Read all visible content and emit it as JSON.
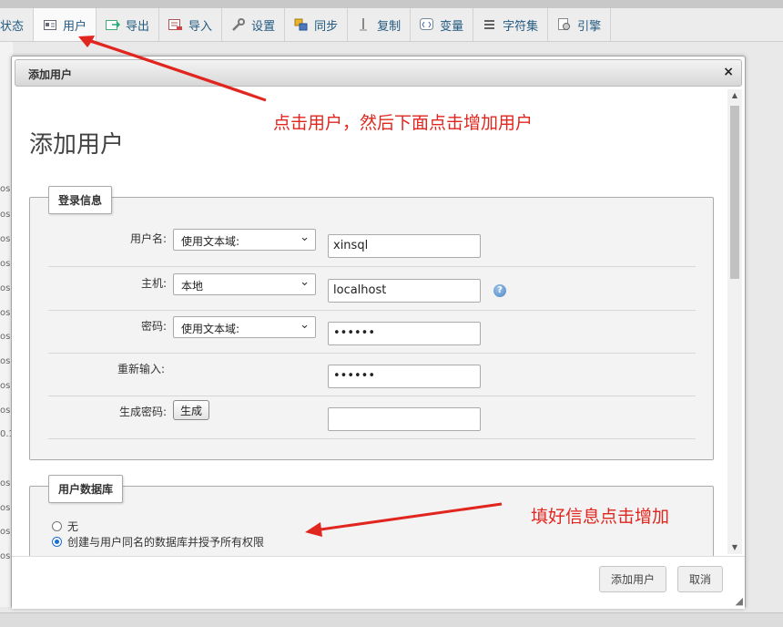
{
  "tabs": [
    {
      "label": "状态",
      "icon": "status-icon"
    },
    {
      "label": "用户",
      "icon": "users-icon"
    },
    {
      "label": "导出",
      "icon": "export-icon"
    },
    {
      "label": "导入",
      "icon": "import-icon"
    },
    {
      "label": "设置",
      "icon": "wrench-icon"
    },
    {
      "label": "同步",
      "icon": "sync-icon"
    },
    {
      "label": "复制",
      "icon": "replication-icon"
    },
    {
      "label": "变量",
      "icon": "variables-icon"
    },
    {
      "label": "字符集",
      "icon": "charset-icon"
    },
    {
      "label": "引擎",
      "icon": "engine-icon"
    }
  ],
  "background": {
    "rows": [
      "os",
      "os",
      "os",
      "os",
      "os",
      "os",
      "os",
      "os",
      "os",
      "os",
      "0.1",
      "os",
      "os",
      "os",
      "os"
    ]
  },
  "dialog": {
    "title": "添加用户",
    "close_glyph": "×",
    "heading": "添加用户",
    "login": {
      "legend": "登录信息",
      "username_label": "用户名:",
      "username_select": "使用文本域:",
      "username_value": "xinsql",
      "host_label": "主机:",
      "host_select": "本地",
      "host_value": "localhost",
      "password_label": "密码:",
      "password_select": "使用文本域:",
      "password_value": "••••••",
      "retype_label": "重新输入:",
      "retype_value": "••••••",
      "generate_label": "生成密码:",
      "generate_button": "生成",
      "generate_value": ""
    },
    "database": {
      "legend": "用户数据库",
      "option_none": "无",
      "option_create": "创建与用户同名的数据库并授予所有权限",
      "selected": "option_create"
    },
    "footer": {
      "add_button": "添加用户",
      "cancel_button": "取消"
    }
  },
  "annotations": {
    "note_top": "点击用户，然后下面点击增加用户",
    "note_bottom": "填好信息点击增加",
    "color": "#e0261f"
  }
}
